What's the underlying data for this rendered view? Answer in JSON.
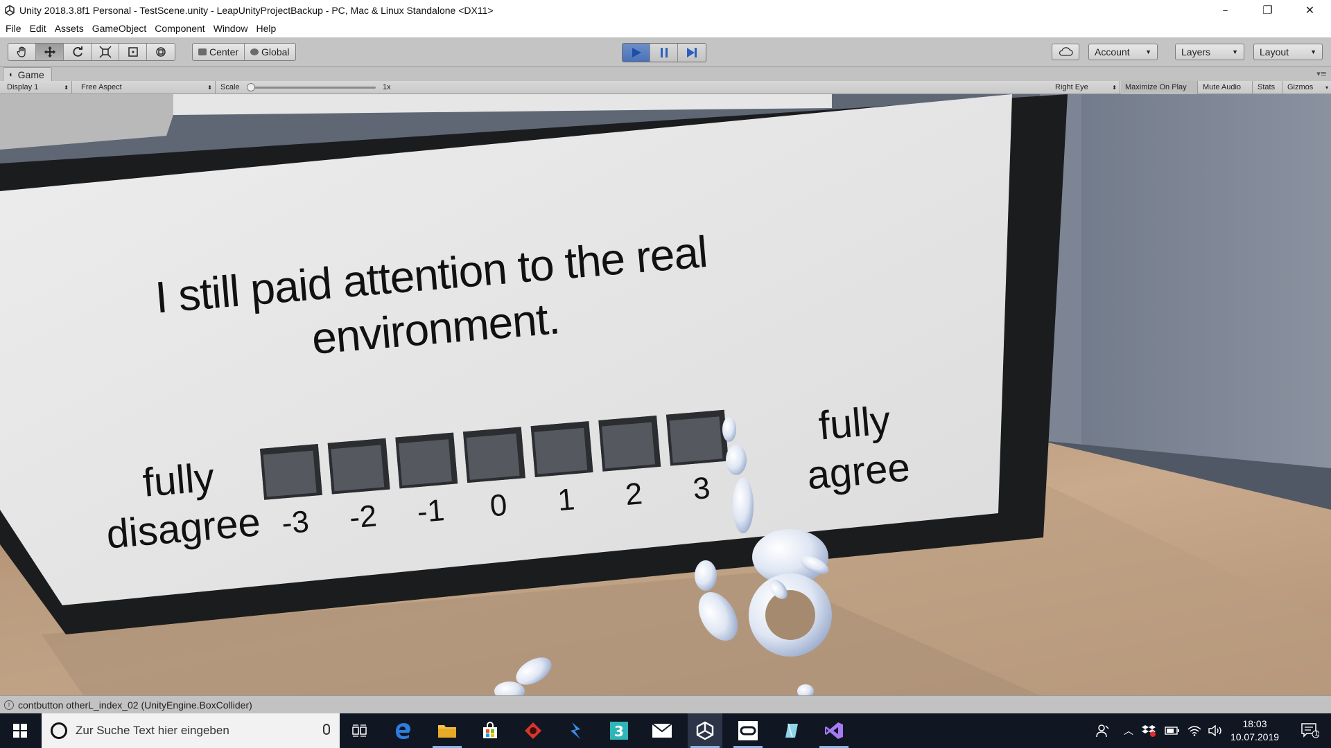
{
  "window": {
    "title": "Unity 2018.3.8f1 Personal - TestScene.unity - LeapUnityProjectBackup - PC, Mac & Linux Standalone <DX11>",
    "minimize": "–",
    "maximize": "❐",
    "close": "✕"
  },
  "menu": [
    "File",
    "Edit",
    "Assets",
    "GameObject",
    "Component",
    "Window",
    "Help"
  ],
  "toolbar": {
    "tools": [
      "hand-icon",
      "move-icon",
      "rotate-icon",
      "scale-icon",
      "rect-icon",
      "transform-icon"
    ],
    "pivot": "Center",
    "space": "Global",
    "play_state": "playing",
    "account": "Account",
    "layers": "Layers",
    "layout": "Layout"
  },
  "game": {
    "tab_label": "Game",
    "display": "Display 1",
    "aspect": "Free Aspect",
    "scale_label": "Scale",
    "scale_value": "1x",
    "eye": "Right Eye",
    "maximize_on_play": "Maximize On Play",
    "mute_audio": "Mute Audio",
    "stats": "Stats",
    "gizmos": "Gizmos"
  },
  "scene": {
    "question_line1": "I still paid attention to the real",
    "question_line2": "environment.",
    "left_label_1": "fully",
    "left_label_2": "disagree",
    "right_label_1": "fully",
    "right_label_2": "agree",
    "scale": [
      "-3",
      "-2",
      "-1",
      "0",
      "1",
      "2",
      "3"
    ]
  },
  "status": {
    "message": "contbutton otherL_index_02 (UnityEngine.BoxCollider)"
  },
  "taskbar": {
    "search_placeholder": "Zur Suche Text hier eingeben",
    "time": "18:03",
    "date": "10.07.2019",
    "notification_count": "1"
  }
}
